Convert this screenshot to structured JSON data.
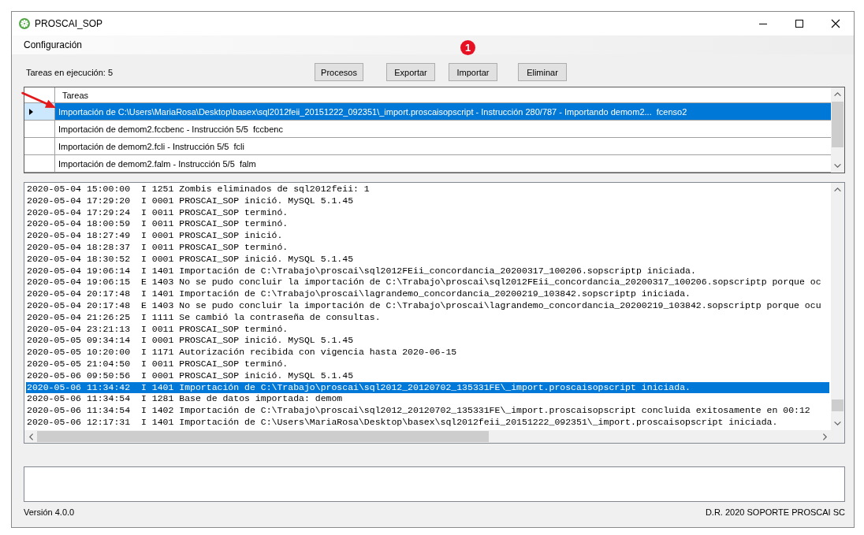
{
  "window": {
    "title": "PROSCAI_SOP"
  },
  "menu": [
    "Configuración"
  ],
  "annotation": {
    "badge": "1"
  },
  "toolbar": {
    "status": "Tareas en ejecución: 5",
    "buttons": [
      "Procesos",
      "Exportar",
      "Importar",
      "Eliminar"
    ]
  },
  "task_grid": {
    "columns": [
      "Tareas"
    ],
    "rows": [
      {
        "text": "Importación de C:\\Users\\MariaRosa\\Desktop\\basex\\sql2012feii_20151222_092351\\_import.proscaisopscript - Instrucción 280/787 - Importando demom2...  fcenso2",
        "selected": true
      },
      {
        "text": "Importación de demom2.fccbenc - Instrucción 5/5  fccbenc",
        "selected": false
      },
      {
        "text": "Importación de demom2.fcli - Instrucción 5/5  fcli",
        "selected": false
      },
      {
        "text": "Importación de demom2.falm - Instrucción 5/5  falm",
        "selected": false
      }
    ]
  },
  "log": {
    "lines": [
      {
        "text": "2020-05-04 15:00:00  I 1251 Zombis eliminados de sql2012feii: 1",
        "selected": false
      },
      {
        "text": "2020-05-04 17:29:20  I 0001 PROSCAI_SOP inició. MySQL 5.1.45",
        "selected": false
      },
      {
        "text": "2020-05-04 17:29:24  I 0011 PROSCAI_SOP terminó.",
        "selected": false
      },
      {
        "text": "2020-05-04 18:00:59  I 0011 PROSCAI_SOP terminó.",
        "selected": false
      },
      {
        "text": "2020-05-04 18:27:49  I 0001 PROSCAI_SOP inició.",
        "selected": false
      },
      {
        "text": "2020-05-04 18:28:37  I 0011 PROSCAI_SOP terminó.",
        "selected": false
      },
      {
        "text": "2020-05-04 18:30:52  I 0001 PROSCAI_SOP inició. MySQL 5.1.45",
        "selected": false
      },
      {
        "text": "2020-05-04 19:06:14  I 1401 Importación de C:\\Trabajo\\proscai\\sql2012FEii_concordancia_20200317_100206.sopscriptp iniciada.",
        "selected": false
      },
      {
        "text": "2020-05-04 19:06:15  E 1403 No se pudo concluir la importación de C:\\Trabajo\\proscai\\sql2012FEii_concordancia_20200317_100206.sopscriptp porque oc",
        "selected": false
      },
      {
        "text": "2020-05-04 20:17:48  I 1401 Importación de C:\\Trabajo\\proscai\\lagrandemo_concordancia_20200219_103842.sopscriptp iniciada.",
        "selected": false
      },
      {
        "text": "2020-05-04 20:17:48  E 1403 No se pudo concluir la importación de C:\\Trabajo\\proscai\\lagrandemo_concordancia_20200219_103842.sopscriptp porque ocu",
        "selected": false
      },
      {
        "text": "2020-05-04 21:26:25  I 1111 Se cambió la contraseña de consultas.",
        "selected": false
      },
      {
        "text": "2020-05-04 23:21:13  I 0011 PROSCAI_SOP terminó.",
        "selected": false
      },
      {
        "text": "2020-05-05 09:34:14  I 0001 PROSCAI_SOP inició. MySQL 5.1.45",
        "selected": false
      },
      {
        "text": "2020-05-05 10:20:00  I 1171 Autorización recibida con vigencia hasta 2020-06-15",
        "selected": false
      },
      {
        "text": "2020-05-05 21:04:50  I 0011 PROSCAI_SOP terminó.",
        "selected": false
      },
      {
        "text": "2020-05-06 09:50:56  I 0001 PROSCAI_SOP inició. MySQL 5.1.45",
        "selected": false
      },
      {
        "text": "2020-05-06 11:34:42  I 1401 Importación de C:\\Trabajo\\proscai\\sql2012_20120702_135331FE\\_import.proscaisopscript iniciada.",
        "selected": true
      },
      {
        "text": "2020-05-06 11:34:54  I 1281 Base de datos importada: demom",
        "selected": false
      },
      {
        "text": "2020-05-06 11:34:54  I 1402 Importación de C:\\Trabajo\\proscai\\sql2012_20120702_135331FE\\_import.proscaisopscript concluida exitosamente en 00:12",
        "selected": false
      },
      {
        "text": "2020-05-06 12:17:31  I 1401 Importación de C:\\Users\\MariaRosa\\Desktop\\basex\\sql2012feii_20151222_092351\\_import.proscaisopscript iniciada.",
        "selected": false
      }
    ]
  },
  "footer": {
    "version": "Versión 4.0.0",
    "copyright": "D.R. 2020 SOPORTE PROSCAI SC"
  }
}
